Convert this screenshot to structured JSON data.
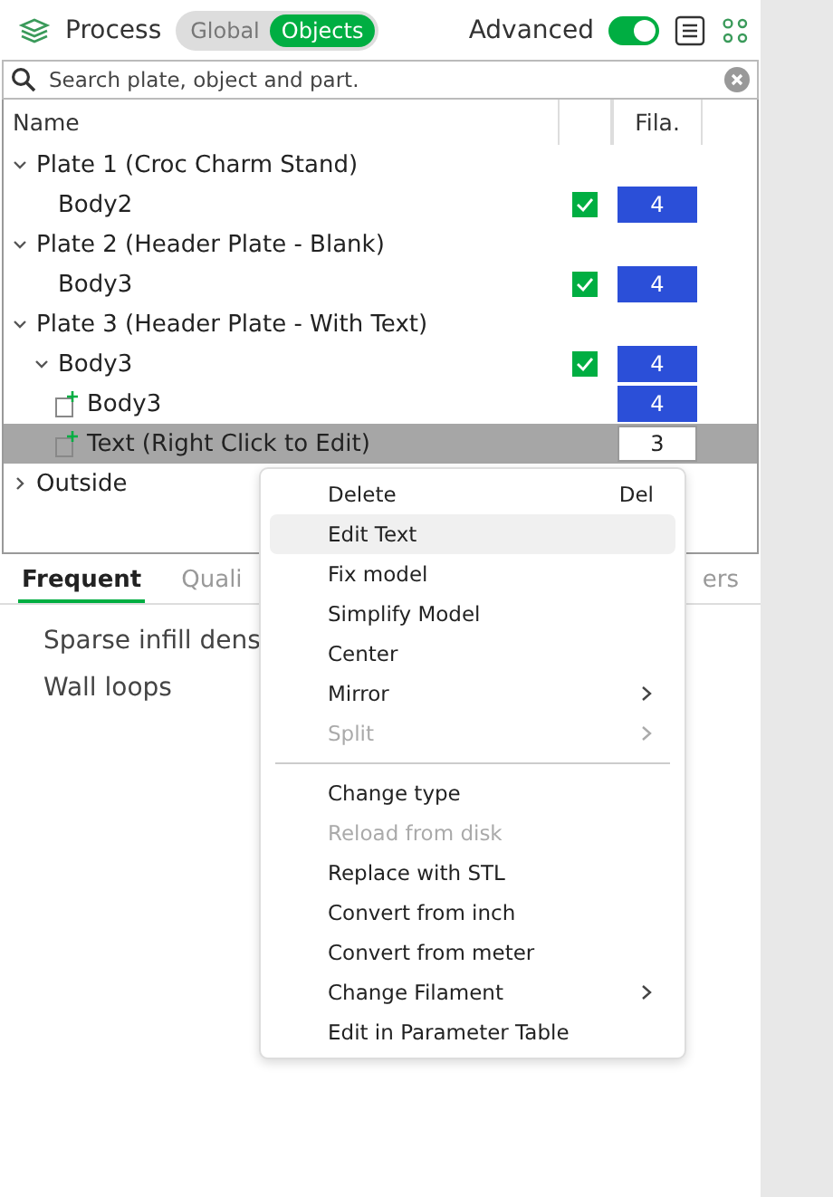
{
  "header": {
    "title": "Process",
    "modes": [
      {
        "label": "Global",
        "selected": false
      },
      {
        "label": "Objects",
        "selected": true
      }
    ],
    "advanced": {
      "label": "Advanced",
      "on": true
    }
  },
  "search": {
    "placeholder": "Search plate, object and part."
  },
  "table": {
    "columns": [
      "Name",
      "Fila."
    ],
    "rows": [
      {
        "kind": "plate",
        "name": "Plate 1 (Croc Charm Stand)",
        "expanded": true,
        "selected": false,
        "children": [
          {
            "kind": "object",
            "name": "Body2",
            "checked": true,
            "filament": "4",
            "color": "#2b4fd8",
            "selected": false
          }
        ]
      },
      {
        "kind": "plate",
        "name": "Plate 2 (Header Plate - Blank)",
        "expanded": true,
        "selected": false,
        "children": [
          {
            "kind": "object",
            "name": "Body3",
            "checked": true,
            "filament": "4",
            "color": "#2b4fd8",
            "selected": false
          }
        ]
      },
      {
        "kind": "plate",
        "name": "Plate 3 (Header Plate - With Text)",
        "expanded": true,
        "selected": false,
        "children": [
          {
            "kind": "object",
            "name": "Body3",
            "checked": true,
            "filament": "4",
            "color": "#2b4fd8",
            "expanded": true,
            "selected": false,
            "children": [
              {
                "kind": "part",
                "name": "Body3",
                "filament": "4",
                "color": "#2b4fd8",
                "selected": false
              },
              {
                "kind": "part",
                "name": "Text (Right Click to Edit)",
                "filament": "3",
                "color": "#ffffff",
                "selected": true
              }
            ]
          }
        ]
      },
      {
        "kind": "plate",
        "name": "Outside",
        "expanded": false,
        "selected": false
      }
    ]
  },
  "tabs": [
    {
      "label": "Frequent",
      "selected": true
    },
    {
      "label": "Quali",
      "selected": false
    },
    {
      "label": "ers",
      "selected": false
    }
  ],
  "settings": [
    "Sparse infill dens",
    "Wall loops"
  ],
  "menu": [
    {
      "kind": "item",
      "label": "Delete",
      "shortcut": "Del",
      "disabled": false,
      "selected": false
    },
    {
      "kind": "item",
      "label": "Edit Text",
      "submenu": false,
      "disabled": false,
      "selected": true
    },
    {
      "kind": "item",
      "label": "Fix model",
      "submenu": false,
      "disabled": false,
      "selected": false
    },
    {
      "kind": "item",
      "label": "Simplify Model",
      "submenu": false,
      "disabled": false,
      "selected": false
    },
    {
      "kind": "item",
      "label": "Center",
      "submenu": false,
      "disabled": false,
      "selected": false
    },
    {
      "kind": "item",
      "label": "Mirror",
      "submenu": true,
      "disabled": false,
      "selected": false
    },
    {
      "kind": "item",
      "label": "Split",
      "submenu": true,
      "disabled": true,
      "selected": false
    },
    {
      "kind": "separator"
    },
    {
      "kind": "item",
      "label": "Change type",
      "submenu": false,
      "disabled": false,
      "selected": false
    },
    {
      "kind": "item",
      "label": "Reload from disk",
      "submenu": false,
      "disabled": true,
      "selected": false
    },
    {
      "kind": "item",
      "label": "Replace with STL",
      "submenu": false,
      "disabled": false,
      "selected": false
    },
    {
      "kind": "item",
      "label": "Convert from inch",
      "submenu": false,
      "disabled": false,
      "selected": false
    },
    {
      "kind": "item",
      "label": "Convert from meter",
      "submenu": false,
      "disabled": false,
      "selected": false
    },
    {
      "kind": "item",
      "label": "Change Filament",
      "submenu": true,
      "disabled": false,
      "selected": false
    },
    {
      "kind": "item",
      "label": "Edit in Parameter Table",
      "submenu": false,
      "disabled": false,
      "selected": false
    }
  ]
}
